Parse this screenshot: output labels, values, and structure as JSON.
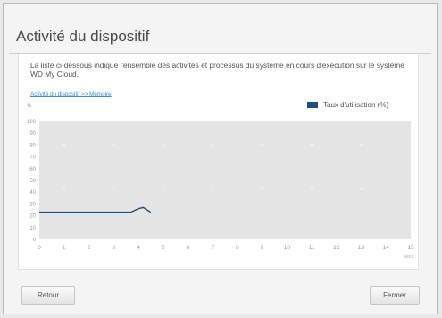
{
  "dialog": {
    "title": "Activité du dispositif",
    "description": "La liste ci-dessous indique l'ensemble des activités et processus du système en cours d'exécution sur le système WD My Cloud.",
    "breadcrumb_link": "Activité du dispositif >> Mémoire"
  },
  "buttons": {
    "back_label": "Retour",
    "close_label": "Fermer"
  },
  "colors": {
    "series": "#1f4f7b",
    "plot_background": "#e5e5e5",
    "link": "#3a8ed6"
  },
  "chart_data": {
    "type": "line",
    "ylabel": "%",
    "xlabel": "secs",
    "ylim": [
      0,
      100
    ],
    "xlim": [
      0,
      15
    ],
    "yticks": [
      0,
      10,
      20,
      30,
      40,
      50,
      60,
      70,
      80,
      90,
      100
    ],
    "xticks": [
      0,
      1,
      2,
      3,
      4,
      5,
      6,
      7,
      8,
      9,
      10,
      11,
      12,
      13,
      14,
      15
    ],
    "grid": false,
    "legend_position": "top-right",
    "series": [
      {
        "name": "Taux d'utilisation (%)",
        "x": [
          0,
          1,
          2,
          3,
          3.7,
          4,
          4.2,
          4.5
        ],
        "y": [
          23,
          23,
          23,
          23,
          23,
          26,
          27,
          23
        ]
      }
    ]
  }
}
